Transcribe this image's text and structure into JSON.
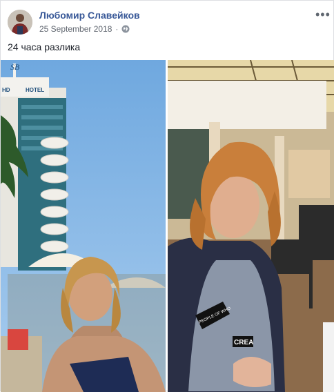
{
  "post": {
    "author": "Любомир Славейков",
    "date": "25 September 2018",
    "privacy_icon": "globe-icon",
    "more_icon": "more-options-icon",
    "text": "24 часа разлика"
  },
  "photo_left": {
    "hotel_sign": "HOTEL",
    "logo_text": "SB",
    "left_sign": "HD"
  },
  "photo_right": {
    "shirt_patch": "PEOPLE OF WHO",
    "shirt_patch_2": "CREA"
  },
  "colors": {
    "author_link": "#385898",
    "meta_text": "#616770",
    "body_text": "#1d2129"
  }
}
